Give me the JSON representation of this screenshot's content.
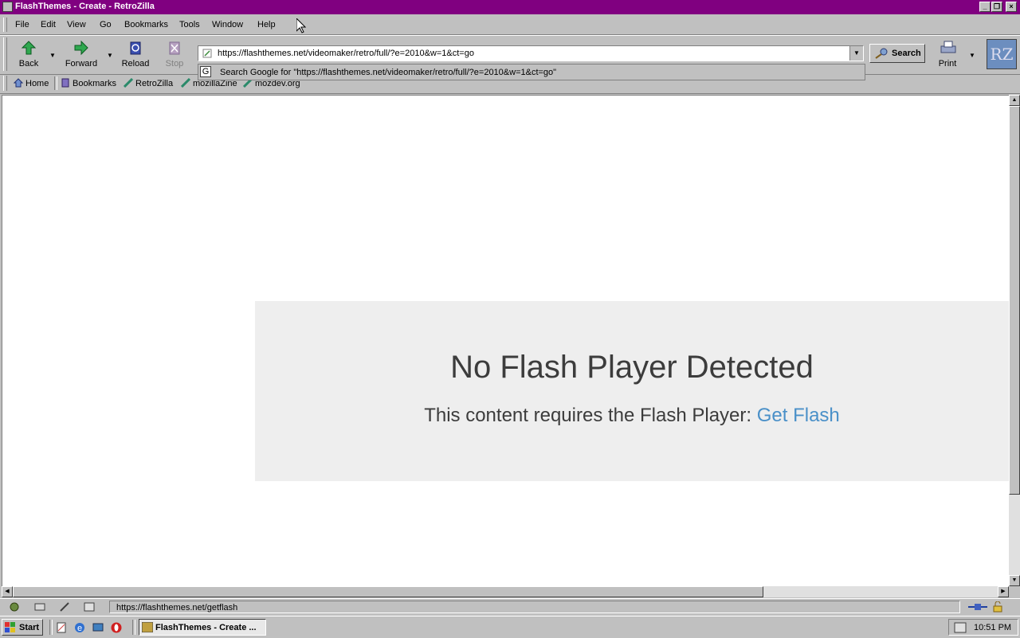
{
  "window": {
    "title": "FlashThemes - Create - RetroZilla",
    "caption_buttons": [
      "minimize",
      "restore",
      "close"
    ]
  },
  "menu": {
    "items": [
      "File",
      "Edit",
      "View",
      "Go",
      "Bookmarks",
      "Tools",
      "Window",
      "Help"
    ]
  },
  "toolbar": {
    "back_label": "Back",
    "forward_label": "Forward",
    "reload_label": "Reload",
    "stop_label": "Stop",
    "search_label": "Search",
    "print_label": "Print",
    "logo_text": "RZ"
  },
  "urlbar": {
    "value": "https://flashthemes.net/videomaker/retro/full/?e=2010&w=1&ct=go"
  },
  "autocomplete": {
    "suggestion": "Search Google for \"https://flashthemes.net/videomaker/retro/full/?e=2010&w=1&ct=go\""
  },
  "personal_toolbar": {
    "items": [
      "Home",
      "Bookmarks",
      "RetroZilla",
      "mozillaZine",
      "mozdev.org"
    ]
  },
  "page": {
    "heading": "No Flash Player Detected",
    "message": "This content requires the Flash Player:",
    "link": "Get Flash"
  },
  "statusbar": {
    "text": "https://flashthemes.net/getflash"
  },
  "taskbar": {
    "start_label": "Start",
    "task_label": "FlashThemes - Create ...",
    "clock": "10:51 PM"
  },
  "colors": {
    "titlebar": "#800080",
    "face": "#c0c0c0",
    "flash_box": "#eeeeee",
    "link": "#4a90c8"
  }
}
